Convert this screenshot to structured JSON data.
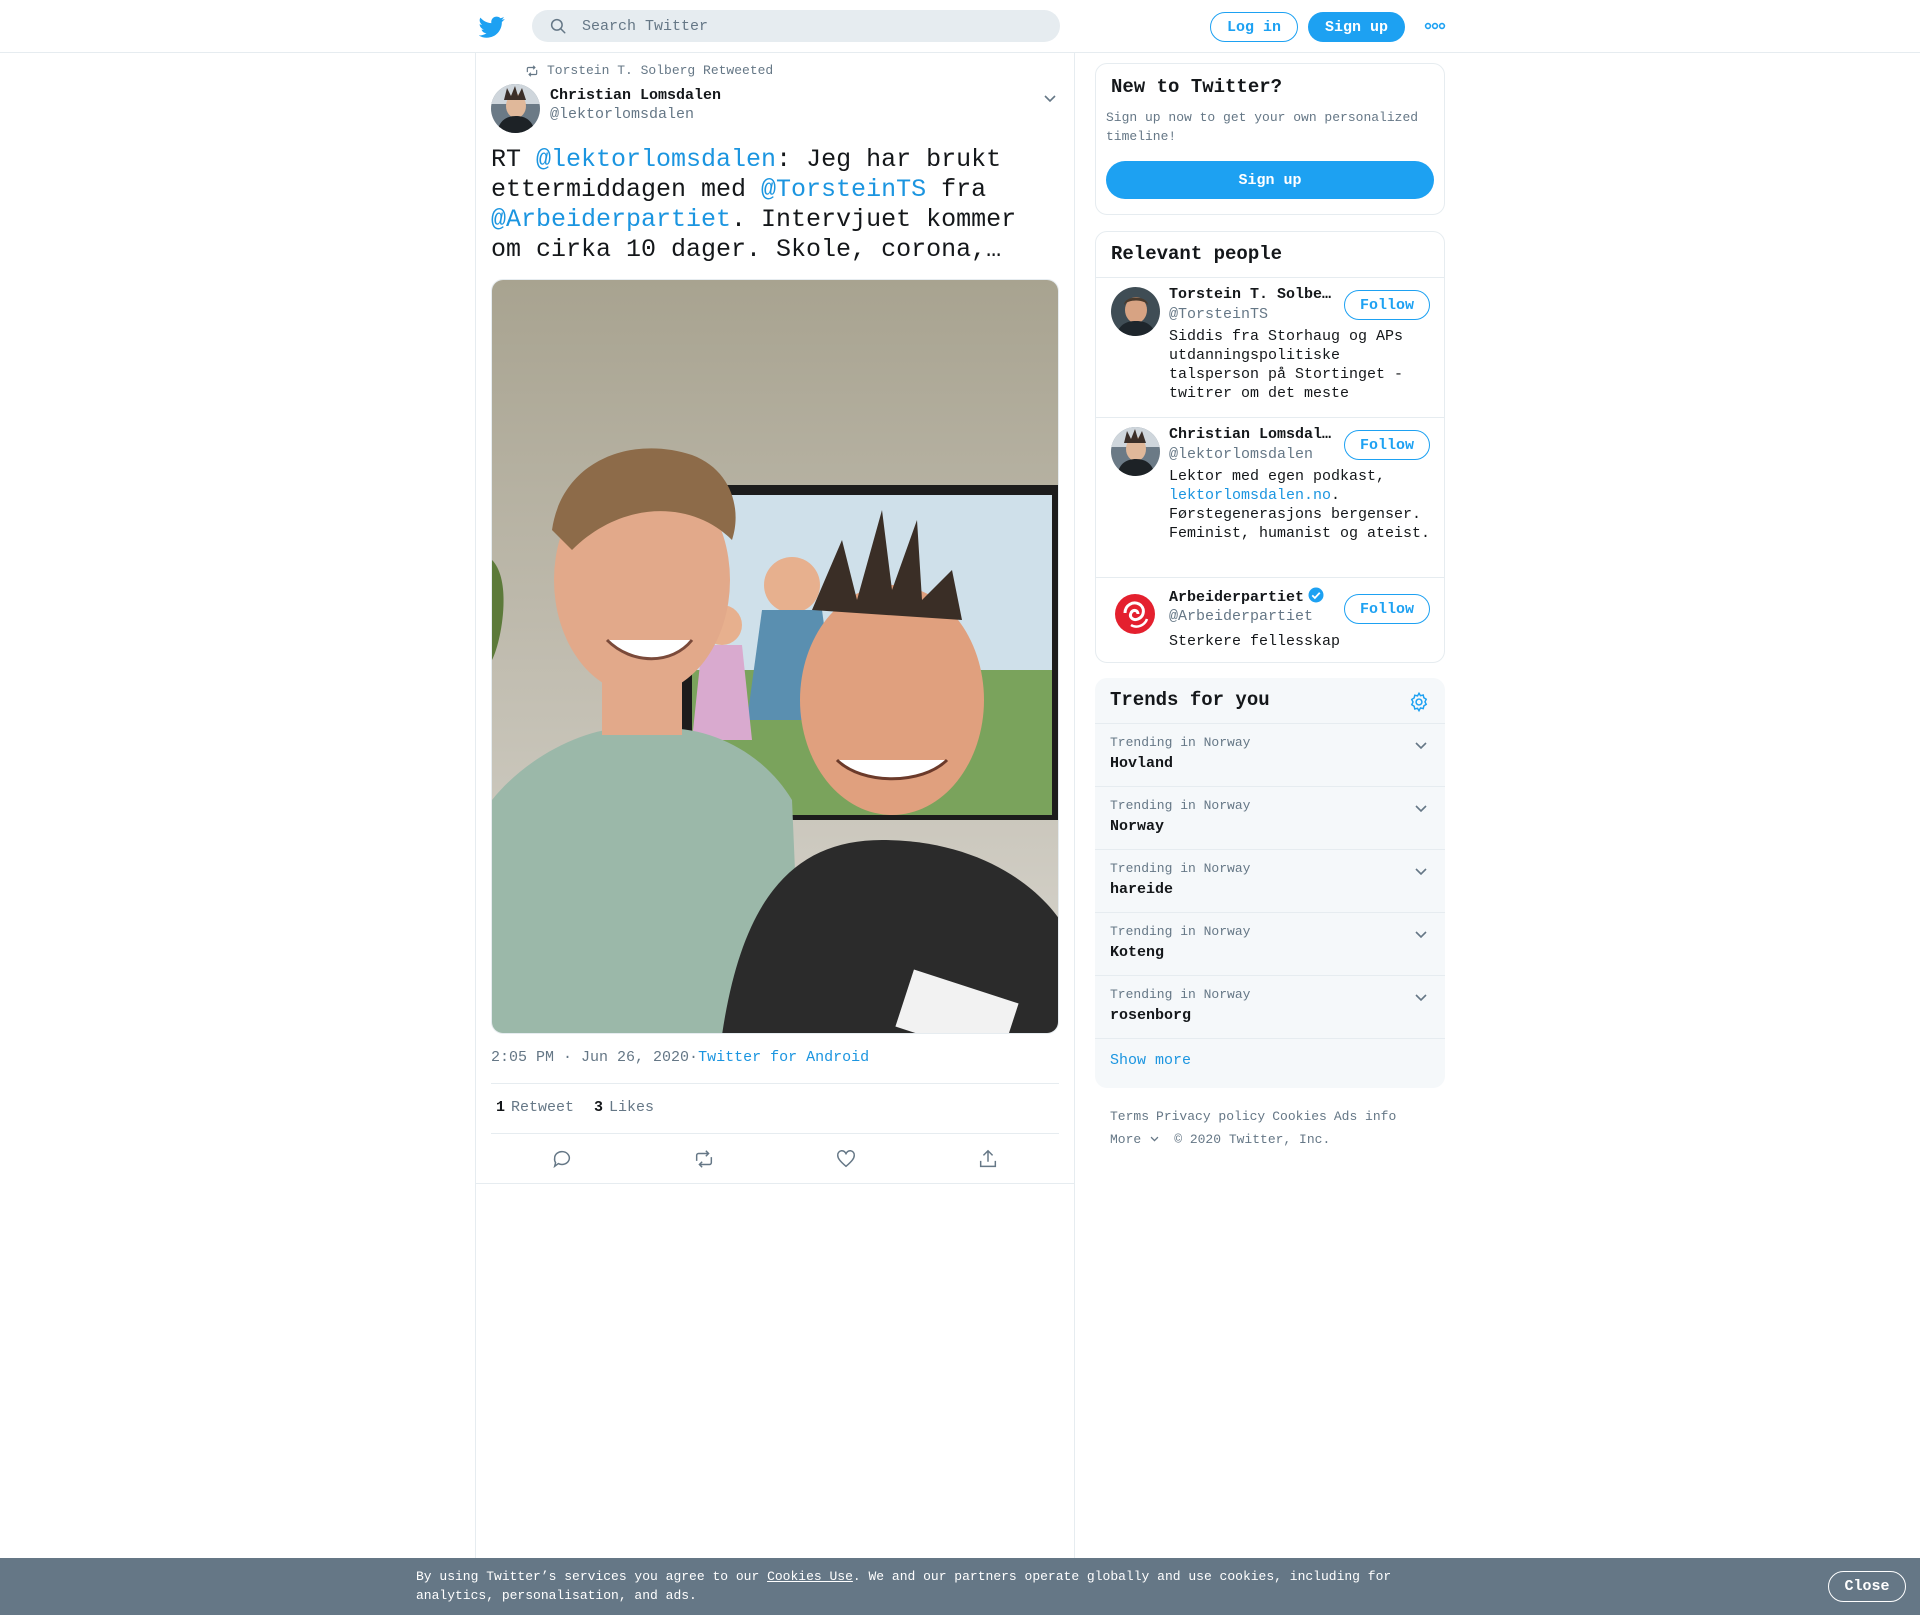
{
  "header": {
    "search_placeholder": "Search Twitter",
    "login_label": "Log in",
    "signup_label": "Sign up"
  },
  "tweet": {
    "retweeted_by": "Torstein T. Solberg Retweeted",
    "author_name": "Christian Lomsdalen",
    "author_handle": "@lektorlomsdalen",
    "text_parts": {
      "p1": "RT ",
      "m1": "@lektorlomsdalen",
      "p2": ": Jeg har brukt ettermiddagen med ",
      "m2": "@TorsteinTS",
      "p3": " fra ",
      "m3": "@Arbeiderpartiet",
      "p4": ". Intervjuet kommer om cirka 10 dager. Skole, corona,…"
    },
    "timestamp": "2:05 PM · Jun 26, 2020",
    "meta_sep": " · ",
    "source": "Twitter for Android",
    "retweet_count": "1",
    "retweet_label": "Retweet",
    "like_count": "3",
    "like_label": "Likes"
  },
  "sidebar": {
    "new_to_twitter": {
      "title": "New to Twitter?",
      "subtitle": "Sign up now to get your own personalized timeline!",
      "signup_label": "Sign up"
    },
    "relevant_people": {
      "title": "Relevant people",
      "people": [
        {
          "name": "Torstein T. Solberg",
          "handle": "@TorsteinTS",
          "bio": "Siddis fra Storhaug og APs utdanningspolitiske talsperson på Stortinget - twitrer om det meste",
          "follow_label": "Follow"
        },
        {
          "name": "Christian Lomsdalen",
          "handle": "@lektorlomsdalen",
          "bio_p1": "Lektor med egen podkast, ",
          "bio_link": "lektorlomsdalen.no",
          "bio_p2": ". Førstegenerasjons bergenser. Feminist, humanist og ateist.",
          "follow_label": "Follow"
        },
        {
          "name": "Arbeiderpartiet",
          "handle": "@Arbeiderpartiet",
          "bio": "Sterkere fellesskap",
          "follow_label": "Follow"
        }
      ]
    },
    "trends": {
      "title": "Trends for you",
      "items": [
        {
          "context": "Trending in Norway",
          "name": "Hovland"
        },
        {
          "context": "Trending in Norway",
          "name": "Norway"
        },
        {
          "context": "Trending in Norway",
          "name": "hareide"
        },
        {
          "context": "Trending in Norway",
          "name": "Koteng"
        },
        {
          "context": "Trending in Norway",
          "name": "rosenborg"
        }
      ],
      "show_more": "Show more"
    },
    "footer": {
      "terms": "Terms",
      "privacy": "Privacy policy",
      "cookies": "Cookies",
      "ads": "Ads info",
      "more": "More",
      "copyright": "© 2020 Twitter, Inc."
    }
  },
  "cookie_bar": {
    "text_p1": "By using Twitter’s services you agree to our ",
    "link": "Cookies Use",
    "text_p2": ". We and our partners operate globally and use cookies, including for analytics, personalisation, and ads.",
    "close_label": "Close"
  },
  "colors": {
    "brand": "#1da1f2",
    "link": "#1b95e0",
    "secondary_text": "#657786",
    "border": "#e6ecf0",
    "cookie_bar": "#657786"
  },
  "icons": [
    "twitter-bird-icon",
    "search-icon",
    "more-dots-icon",
    "retweet-icon",
    "chevron-down-icon",
    "reply-icon",
    "like-icon",
    "share-icon",
    "gear-icon",
    "verified-icon"
  ]
}
